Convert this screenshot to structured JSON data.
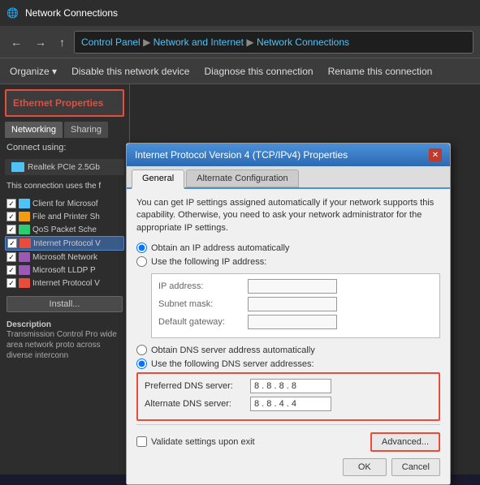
{
  "titlebar": {
    "title": "Network Connections",
    "icon": "🌐"
  },
  "addressbar": {
    "back": "←",
    "forward": "→",
    "up": "↑",
    "breadcrumb": "Control Panel ▶ Network and Internet ▶ Network Connections"
  },
  "toolbar": {
    "organize": "Organize ▾",
    "disable": "Disable this network device",
    "diagnose": "Diagnose this connection",
    "rename": "Rename this connection"
  },
  "ethernet": {
    "title": "Ethernet Properties",
    "tabs": [
      "Networking",
      "Sharing"
    ],
    "connect_using_label": "Connect using:",
    "adapter_name": "Realtek PCIe 2.5Gb",
    "conn_uses_label": "This connection uses the f",
    "components": [
      {
        "checked": true,
        "label": "Client for Microsof",
        "type": "net"
      },
      {
        "checked": true,
        "label": "File and Printer Sh",
        "type": "file"
      },
      {
        "checked": true,
        "label": "QoS Packet Sche",
        "type": "qos"
      },
      {
        "checked": true,
        "label": "Internet Protocol V",
        "type": "ip",
        "highlighted": true
      },
      {
        "checked": true,
        "label": "Microsoft Network",
        "type": "ms"
      },
      {
        "checked": true,
        "label": "Microsoft LLDP P",
        "type": "ms"
      },
      {
        "checked": true,
        "label": "Internet Protocol V",
        "type": "ip"
      }
    ],
    "install_btn": "Install...",
    "description_title": "Description",
    "description_text": "Transmission Control Pro wide area network proto across diverse interconn"
  },
  "dialog": {
    "title": "Internet Protocol Version 4 (TCP/IPv4) Properties",
    "close_btn": "✕",
    "tabs": [
      "General",
      "Alternate Configuration"
    ],
    "active_tab": "General",
    "description": "You can get IP settings assigned automatically if your network supports this capability. Otherwise, you need to ask your network administrator for the appropriate IP settings.",
    "obtain_ip_auto": "Obtain an IP address automatically",
    "use_following_ip": "Use the following IP address:",
    "ip_address_label": "IP address:",
    "subnet_mask_label": "Subnet mask:",
    "default_gateway_label": "Default gateway:",
    "obtain_dns_auto": "Obtain DNS server address automatically",
    "use_following_dns": "Use the following DNS server addresses:",
    "preferred_dns_label": "Preferred DNS server:",
    "preferred_dns_value": "8 . 8 . 8 . 8",
    "alternate_dns_label": "Alternate DNS server:",
    "alternate_dns_value": "8 . 8 . 4 . 4",
    "validate_label": "Validate settings upon exit",
    "advanced_btn": "Advanced...",
    "ok_btn": "OK",
    "cancel_btn": "Cancel"
  }
}
